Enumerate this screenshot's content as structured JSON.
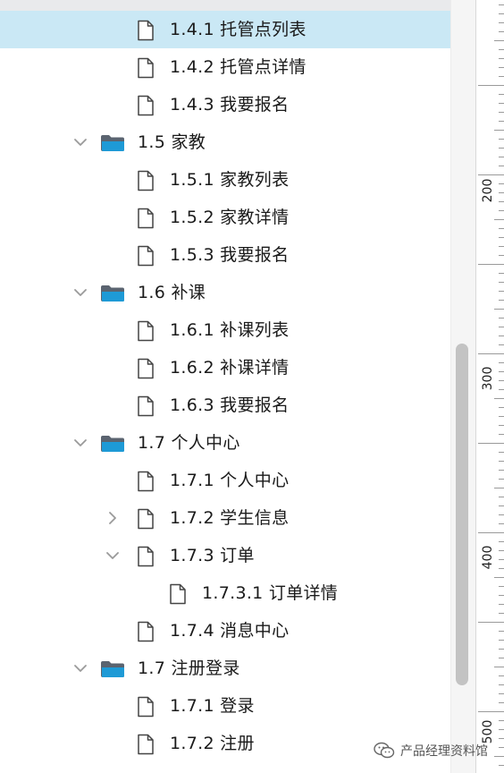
{
  "tree": [
    {
      "label": "1.4.1 托管点列表",
      "type": "page",
      "level": 2,
      "selected": true
    },
    {
      "label": "1.4.2 托管点详情",
      "type": "page",
      "level": 2
    },
    {
      "label": "1.4.3 我要报名",
      "type": "page",
      "level": 2
    },
    {
      "label": "1.5 家教",
      "type": "folder",
      "level": 1,
      "chevron": "expanded"
    },
    {
      "label": "1.5.1 家教列表",
      "type": "page",
      "level": 2
    },
    {
      "label": "1.5.2 家教详情",
      "type": "page",
      "level": 2
    },
    {
      "label": "1.5.3 我要报名",
      "type": "page",
      "level": 2
    },
    {
      "label": "1.6 补课",
      "type": "folder",
      "level": 1,
      "chevron": "expanded"
    },
    {
      "label": "1.6.1 补课列表",
      "type": "page",
      "level": 2
    },
    {
      "label": "1.6.2 补课详情",
      "type": "page",
      "level": 2
    },
    {
      "label": "1.6.3 我要报名",
      "type": "page",
      "level": 2
    },
    {
      "label": "1.7 个人中心",
      "type": "folder",
      "level": 1,
      "chevron": "expanded"
    },
    {
      "label": "1.7.1 个人中心",
      "type": "page",
      "level": 2
    },
    {
      "label": "1.7.2 学生信息",
      "type": "page",
      "level": 2,
      "chevron": "collapsed"
    },
    {
      "label": "1.7.3 订单",
      "type": "page",
      "level": 2,
      "chevron": "expanded"
    },
    {
      "label": "1.7.3.1 订单详情",
      "type": "page",
      "level": 3
    },
    {
      "label": "1.7.4 消息中心",
      "type": "page",
      "level": 2
    },
    {
      "label": "1.7 注册登录",
      "type": "folder",
      "level": 1,
      "chevron": "expanded"
    },
    {
      "label": "1.7.1 登录",
      "type": "page",
      "level": 2
    },
    {
      "label": "1.7.2 注册",
      "type": "page",
      "level": 2
    }
  ],
  "ruler": {
    "labels": [
      "200",
      "300",
      "400",
      "500"
    ]
  },
  "watermark": {
    "text": "产品经理资料馆",
    "icon": "wechat-icon"
  },
  "colors": {
    "selected_row": "#cae8f5",
    "folder_front": "#1e9ad6",
    "folder_back": "#5b6470",
    "chevron": "#9a9a9a",
    "scroll_thumb": "#c3c3c3"
  }
}
